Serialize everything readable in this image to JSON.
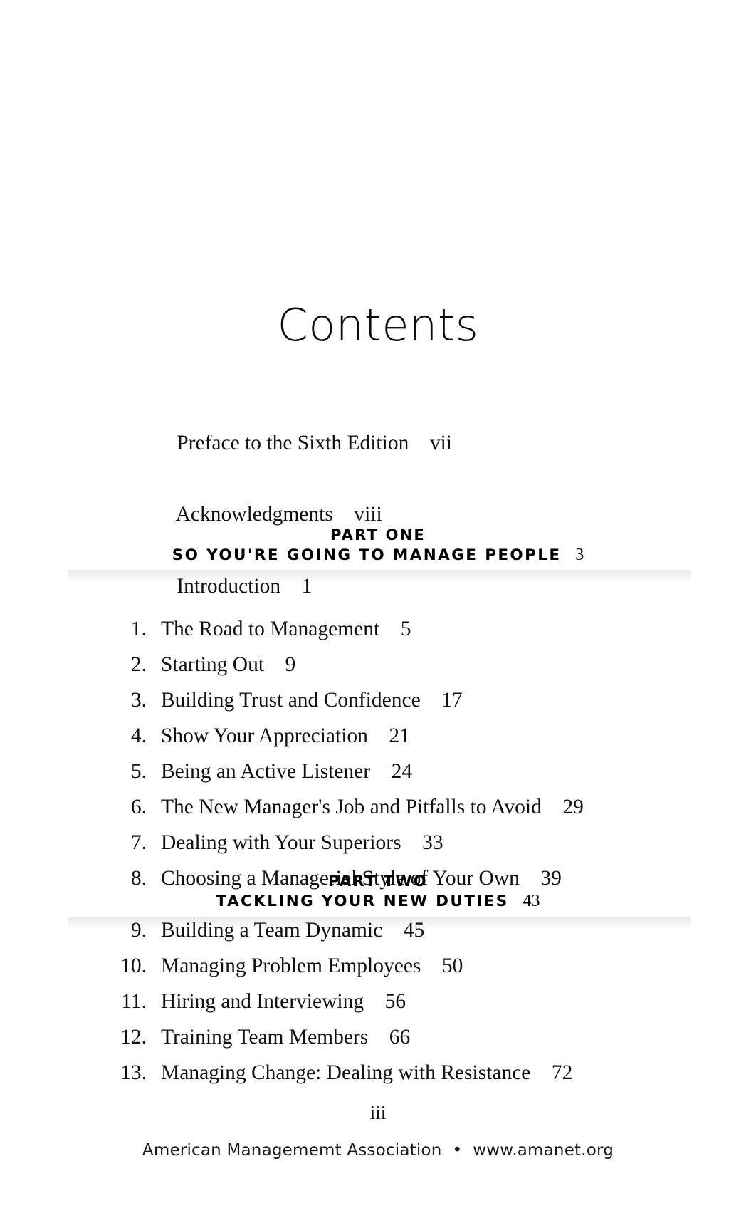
{
  "page": {
    "title": "Contents",
    "folio": "iii",
    "imprint": "American Managememt Association  •  www.amanet.org"
  },
  "front_matter": [
    {
      "label": "Preface to the Sixth Edition",
      "page": "vii"
    },
    {
      "label": "Acknowledgments",
      "page": "viii"
    },
    {
      "label": "Introduction",
      "page": "1"
    }
  ],
  "parts": [
    {
      "label": "PART ONE",
      "name": "SO YOU'RE GOING TO MANAGE PEOPLE",
      "page": "3",
      "chapters": [
        {
          "num": "1.",
          "title": "The Road to Management",
          "page": "5"
        },
        {
          "num": "2.",
          "title": "Starting Out",
          "page": "9"
        },
        {
          "num": "3.",
          "title": "Building Trust and Confidence",
          "page": "17"
        },
        {
          "num": "4.",
          "title": "Show Your Appreciation",
          "page": "21"
        },
        {
          "num": "5.",
          "title": "Being an Active Listener",
          "page": "24"
        },
        {
          "num": "6.",
          "title": "The New Manager's Job and Pitfalls to Avoid",
          "page": "29"
        },
        {
          "num": "7.",
          "title": "Dealing with Your Superiors",
          "page": "33"
        },
        {
          "num": "8.",
          "title": "Choosing a Managerial Style of Your Own",
          "page": "39"
        }
      ]
    },
    {
      "label": "PART TWO",
      "name": "TACKLING YOUR NEW DUTIES",
      "page": "43",
      "chapters": [
        {
          "num": "9.",
          "title": "Building a Team Dynamic",
          "page": "45"
        },
        {
          "num": "10.",
          "title": "Managing Problem Employees",
          "page": "50"
        },
        {
          "num": "11.",
          "title": "Hiring and Interviewing",
          "page": "56"
        },
        {
          "num": "12.",
          "title": "Training Team Members",
          "page": "66"
        },
        {
          "num": "13.",
          "title": "Managing Change: Dealing with Resistance",
          "page": "72"
        }
      ]
    }
  ]
}
